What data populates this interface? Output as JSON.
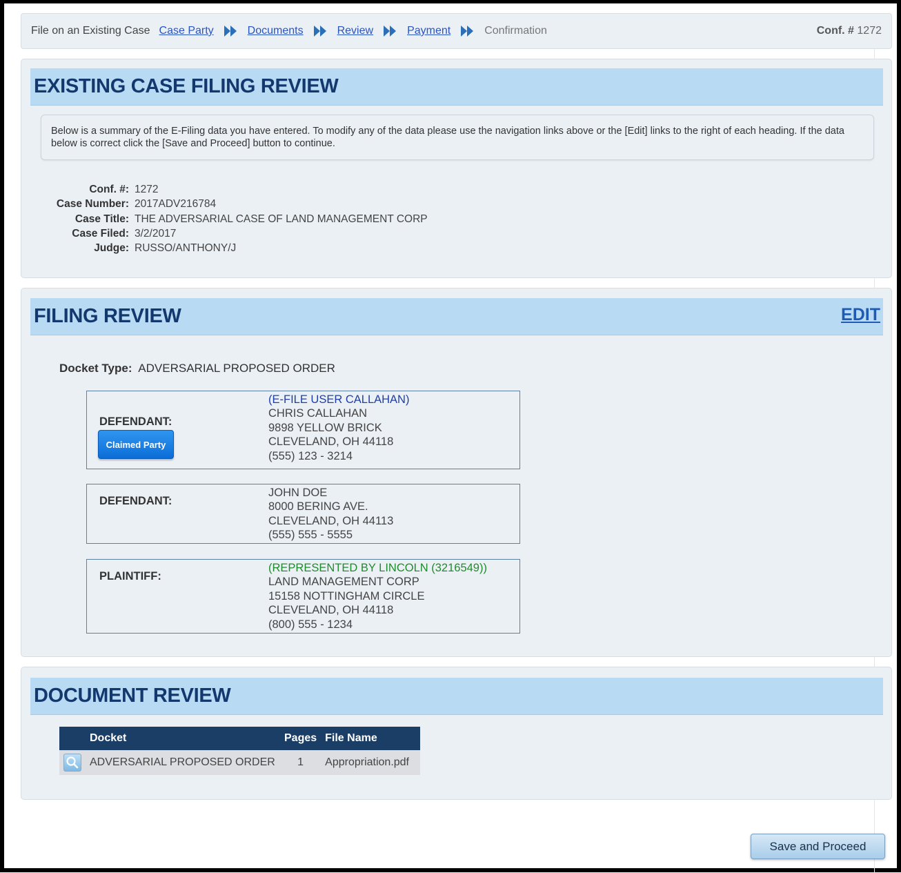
{
  "breadcrumb": {
    "lead": "File on an Existing Case",
    "steps": [
      {
        "label": "Case Party"
      },
      {
        "label": "Documents"
      },
      {
        "label": "Review"
      },
      {
        "label": "Payment"
      }
    ],
    "current": "Confirmation",
    "conf_label": "Conf. #",
    "conf_value": "1272"
  },
  "existing_case": {
    "title": "EXISTING CASE FILING REVIEW",
    "instructions": "Below is a summary of the E-Filing data you have entered. To modify any of the data please use the navigation links above or the [Edit] links to the right of each heading. If the data below is correct click the [Save and Proceed] button to continue.",
    "fields": [
      {
        "label": "Conf. #:",
        "value": "1272"
      },
      {
        "label": "Case Number:",
        "value": "2017ADV216784"
      },
      {
        "label": "Case Title:",
        "value": "THE ADVERSARIAL CASE OF LAND MANAGEMENT CORP"
      },
      {
        "label": "Case Filed:",
        "value": "3/2/2017"
      },
      {
        "label": "Judge:",
        "value": "RUSSO/ANTHONY/J"
      }
    ]
  },
  "filing_review": {
    "title": "FILING REVIEW",
    "edit_label": "EDIT",
    "docket_type_label": "Docket Type:",
    "docket_type_value": "ADVERSARIAL PROPOSED ORDER",
    "parties": [
      {
        "role": "DEFENDANT:",
        "badge": "Claimed Party",
        "note": "(E-FILE USER CALLAHAN)",
        "name": "CHRIS CALLAHAN",
        "address": "9898 YELLOW BRICK",
        "city": "CLEVELAND, OH 44118",
        "phone": "(555) 123 - 3214"
      },
      {
        "role": "DEFENDANT:",
        "name": "JOHN DOE",
        "address": "8000 BERING AVE.",
        "city": "CLEVELAND, OH 44113",
        "phone": "(555) 555 - 5555"
      },
      {
        "role": "PLAINTIFF:",
        "note": "(REPRESENTED BY LINCOLN (3216549))",
        "name": "LAND MANAGEMENT CORP",
        "address": "15158 NOTTINGHAM CIRCLE",
        "city": "CLEVELAND, OH 44118",
        "phone": "(800) 555 - 1234"
      }
    ]
  },
  "document_review": {
    "title": "DOCUMENT REVIEW",
    "columns": [
      "Docket",
      "Pages",
      "File Name"
    ],
    "rows": [
      {
        "docket": "ADVERSARIAL PROPOSED ORDER",
        "pages": "1",
        "file": "Appropriation.pdf",
        "icon": "magnifier-icon"
      }
    ]
  },
  "actions": {
    "save_label": "Save and Proceed"
  },
  "colors": {
    "heading": "#12386e",
    "link": "#2a55c0",
    "section_band": "#b9daf3",
    "table_header": "#1a3e66",
    "note_blue": "#1f3fa8",
    "note_green": "#1e8c2a"
  }
}
